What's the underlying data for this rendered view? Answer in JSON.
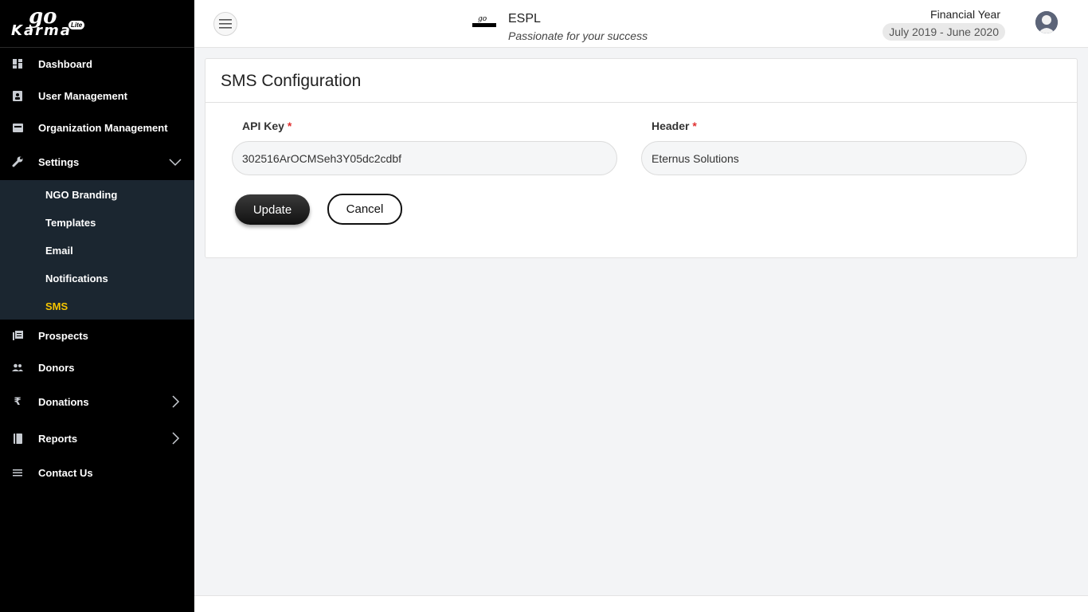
{
  "logo": {
    "go": "go",
    "karma": "Karma",
    "lite": "Lite"
  },
  "sidebar": {
    "items": [
      {
        "label": "Dashboard",
        "icon": "dashboard-icon"
      },
      {
        "label": "User Management",
        "icon": "user-card-icon"
      },
      {
        "label": "Organization Management",
        "icon": "organization-icon"
      },
      {
        "label": "Settings",
        "icon": "wrench-icon"
      },
      {
        "label": "Prospects",
        "icon": "prospects-icon"
      },
      {
        "label": "Donors",
        "icon": "people-icon"
      },
      {
        "label": "Donations",
        "icon": "rupee-icon"
      },
      {
        "label": "Reports",
        "icon": "book-icon"
      },
      {
        "label": "Contact Us",
        "icon": "list-icon"
      }
    ],
    "submenu": [
      "NGO Branding",
      "Templates",
      "Email",
      "Notifications",
      "SMS"
    ],
    "active_sub": "SMS",
    "active_color": "#f5c400"
  },
  "header": {
    "org_name": "ESPL",
    "tagline": "Passionate for your success",
    "fy_label": "Financial Year",
    "fy_value": "July 2019 - June 2020"
  },
  "form": {
    "title": "SMS Configuration",
    "api_key_label": "API Key",
    "api_key_value": "302516ArOCMSeh3Y05dc2cdbf",
    "header_label": "Header",
    "header_value": "Eternus Solutions",
    "required_mark": "*",
    "update_label": "Update",
    "cancel_label": "Cancel"
  }
}
